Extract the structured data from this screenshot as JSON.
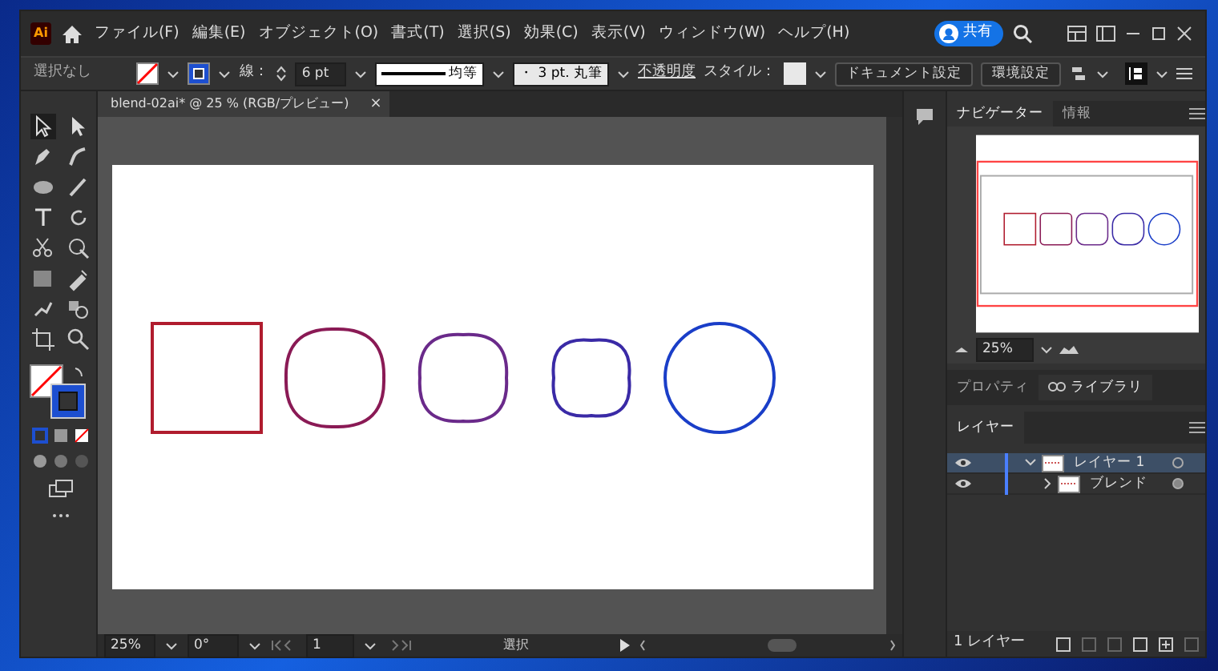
{
  "app": {
    "logo": "Ai",
    "share": "共有"
  },
  "menu": [
    "ファイル(F)",
    "編集(E)",
    "オブジェクト(O)",
    "書式(T)",
    "選択(S)",
    "効果(C)",
    "表示(V)",
    "ウィンドウ(W)",
    "ヘルプ(H)"
  ],
  "control_bar": {
    "selection": "選択なし",
    "stroke_label": "線：",
    "stroke_weight": "6 pt",
    "profile": "均等",
    "brush": "・ 3 pt. 丸筆",
    "opacity": "不透明度",
    "style": "スタイル：",
    "buttons": [
      "ドキュメント設定",
      "環境設定"
    ]
  },
  "document_tab": {
    "title": "blend-02ai* @ 25 % (RGB/プレビュー)",
    "close": "×"
  },
  "artwork": [
    {
      "color": "#b01c2e"
    },
    {
      "color": "#8a1a55"
    },
    {
      "color": "#6a2a8a"
    },
    {
      "color": "#3a2aa6"
    },
    {
      "color": "#1a3ec8"
    }
  ],
  "status_bar": {
    "zoom": "25%",
    "rotation": "0°",
    "artboard": "1",
    "tool": "選択"
  },
  "navigator": {
    "tabs": [
      {
        "label": "ナビゲーター",
        "selected": true
      },
      {
        "label": "情報",
        "selected": false
      }
    ],
    "zoom": "25%"
  },
  "mid_tabs": [
    {
      "label": "プロパティ",
      "selected": false
    },
    {
      "label": "ライブラリ",
      "selected": true
    }
  ],
  "layers": {
    "tab": "レイヤー",
    "items": [
      {
        "name": "レイヤー 1",
        "expanded": true,
        "selected": true,
        "visible": true,
        "children": [
          {
            "name": "ブレンド",
            "expanded": false,
            "selected": false,
            "visible": true
          }
        ]
      }
    ],
    "count": "1 レイヤー"
  }
}
